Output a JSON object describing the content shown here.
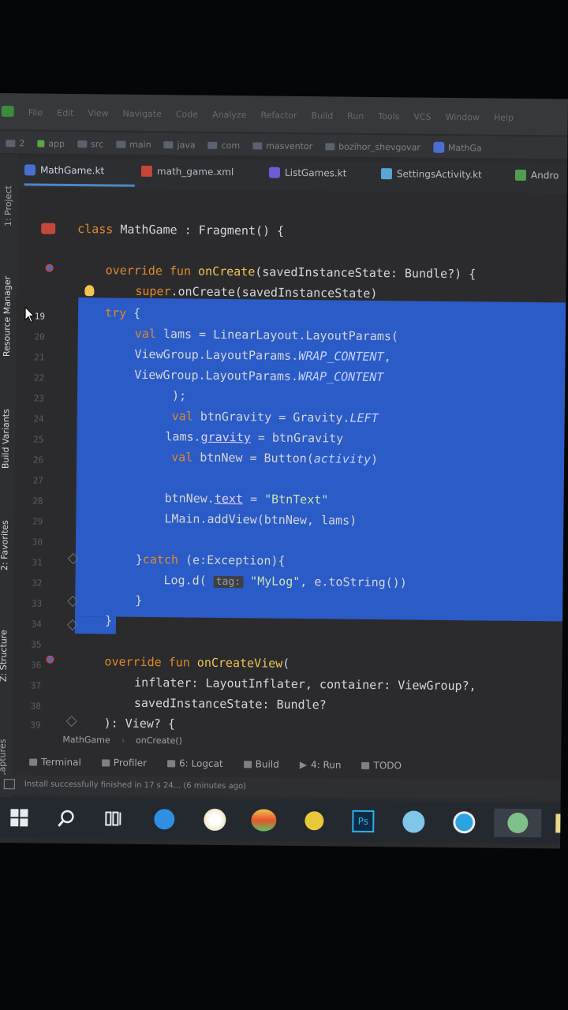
{
  "menu": {
    "items": [
      "File",
      "Edit",
      "View",
      "Navigate",
      "Code",
      "Analyze",
      "Refactor",
      "Build",
      "Run",
      "Tools",
      "VCS",
      "Window",
      "Help"
    ]
  },
  "breadcrumb": {
    "items": [
      "2",
      "app",
      "src",
      "main",
      "java",
      "com",
      "masventor",
      "bozihor_shevgovar",
      "MathGa"
    ]
  },
  "tabs": [
    {
      "label": "MathGame.kt",
      "icon": "kotlin-file-icon"
    },
    {
      "label": "math_game.xml",
      "icon": "xml-file-icon"
    },
    {
      "label": "ListGames.kt",
      "icon": "kotlin-file-icon"
    },
    {
      "label": "SettingsActivity.kt",
      "icon": "activity-file-icon"
    },
    {
      "label": "Andro",
      "icon": "android-icon"
    }
  ],
  "sidebar": {
    "project": "1: Project",
    "resource_manager": "Resource Manager",
    "build_variants": "Build Variants",
    "favorites": "2: Favorites",
    "structure": "Z: Structure",
    "captures": "Captures"
  },
  "editor": {
    "line_numbers": [
      "19",
      "20",
      "21",
      "22",
      "23",
      "24",
      "25",
      "26",
      "27",
      "28",
      "29",
      "30",
      "31",
      "32",
      "33",
      "34",
      "35",
      "36",
      "37",
      "38",
      "39"
    ],
    "code": {
      "l_class": [
        "class",
        " MathGame : Fragment() {"
      ],
      "l_override": [
        "override fun ",
        "onCreate",
        "(savedInstanceState: Bundle?) {"
      ],
      "l_super": [
        "super",
        ".onCreate(savedInstanceState)"
      ],
      "l_try": [
        "try",
        " {"
      ],
      "l_val_lams": [
        "val",
        " lams = LinearLayout.LayoutParams("
      ],
      "l_wrap1": [
        "ViewGroup.LayoutParams.",
        "WRAP_CONTENT",
        ","
      ],
      "l_wrap2": [
        "ViewGroup.LayoutParams.",
        "WRAP_CONTENT"
      ],
      "l_close_paren": [
        ");"
      ],
      "l_gravity_val": [
        "val",
        " btnGravity = Gravity.",
        "LEFT"
      ],
      "l_lams_gravity": [
        "lams.",
        "gravity",
        " = btnGravity"
      ],
      "l_btnnew": [
        "val",
        " btnNew = Button(",
        "activity",
        ")"
      ],
      "l_btntext": [
        "btnNew.",
        "text",
        " = ",
        "\"BtnText\""
      ],
      "l_addview": [
        "LMain.addView(btnNew, lams)"
      ],
      "l_catch": [
        "}",
        "catch",
        " (e:Exception){"
      ],
      "l_log": [
        "Log.d( ",
        "tag:",
        " ",
        "\"MyLog\"",
        ", e.toString())"
      ],
      "l_close1": [
        "}"
      ],
      "l_close2": [
        "}"
      ],
      "l_oncreateview": [
        "override fun ",
        "onCreateView",
        "("
      ],
      "l_inflater": [
        "inflater: LayoutInflater, container: ViewGroup?,"
      ],
      "l_saved": [
        "savedInstanceState: Bundle?"
      ],
      "l_view": [
        "): View? {"
      ]
    }
  },
  "editor_breadcrumb": [
    "MathGame",
    "onCreate()"
  ],
  "bottom_tools": [
    {
      "label": "Terminal"
    },
    {
      "label": "Profiler"
    },
    {
      "label": "6: Logcat"
    },
    {
      "label": "Build"
    },
    {
      "label": "4: Run"
    },
    {
      "label": "TODO"
    }
  ],
  "status": {
    "message": "Install successfully finished in 17 s 24... (6 minutes ago)"
  },
  "taskbar": {
    "items": [
      "windows-start-icon",
      "search-icon",
      "task-view-icon",
      "edge-icon",
      "chrome-icon",
      "photos-icon",
      "warning-app-icon",
      "photoshop-icon",
      "browser-icon",
      "skype-icon",
      "android-studio-icon",
      "file-icon"
    ]
  },
  "colors": {
    "selection": "#2b5bc6",
    "keyword": "#e08a2c",
    "function": "#f2c454",
    "editor_bg": "#2b2b2d"
  }
}
